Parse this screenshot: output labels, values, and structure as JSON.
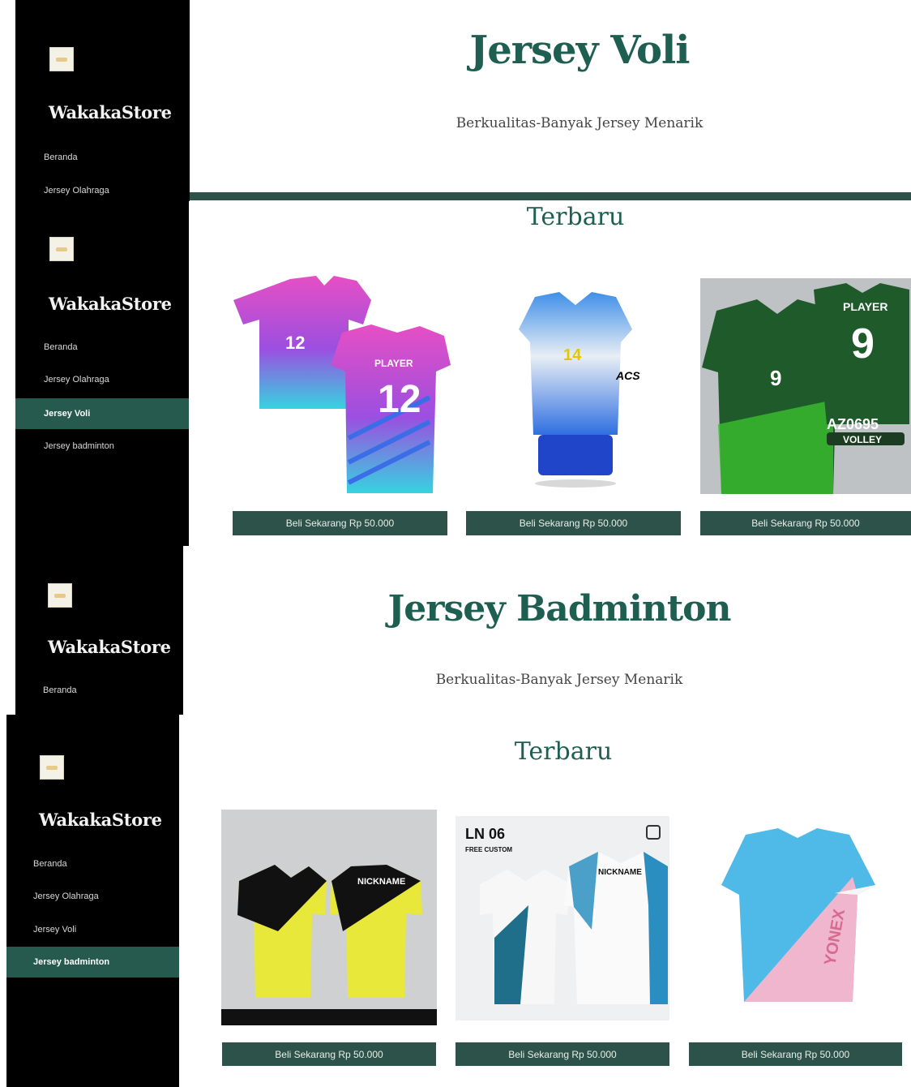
{
  "brand": {
    "name": "WakakaStore"
  },
  "nav": {
    "home": "Beranda",
    "sports": "Jersey Olahraga",
    "volley": "Jersey Voli",
    "badminton": "Jersey badminton"
  },
  "voli": {
    "title": "Jersey Voli",
    "subtitle": "Berkualitas-Banyak Jersey Menarik",
    "section": "Terbaru"
  },
  "badminton": {
    "title": "Jersey Badminton",
    "subtitle": "Berkualitas-Banyak Jersey Menarik",
    "section": "Terbaru"
  },
  "product": {
    "buy_label": "Beli Sekarang Rp 50.000"
  },
  "jersey_prints": {
    "v1_front": "12",
    "v1_back_name": "PLAYER",
    "v1_back_number": "12",
    "v2_number": "14",
    "v2_logo": "ACS",
    "v3_back_name": "PLAYER",
    "v3_front": "9",
    "v3_back": "9",
    "v3_code": "AZ0695",
    "v3_tag": "VOLLEY",
    "b1_name": "NICKNAME",
    "b2_code": "LN 06",
    "b2_note": "FREE CUSTOM",
    "b2_name": "NICKNAME",
    "b3_brand": "YONEX"
  },
  "colors": {
    "accent": "#275a4e",
    "button": "#2c5249",
    "heading": "#1f5f52",
    "sidebar": "#000000"
  }
}
